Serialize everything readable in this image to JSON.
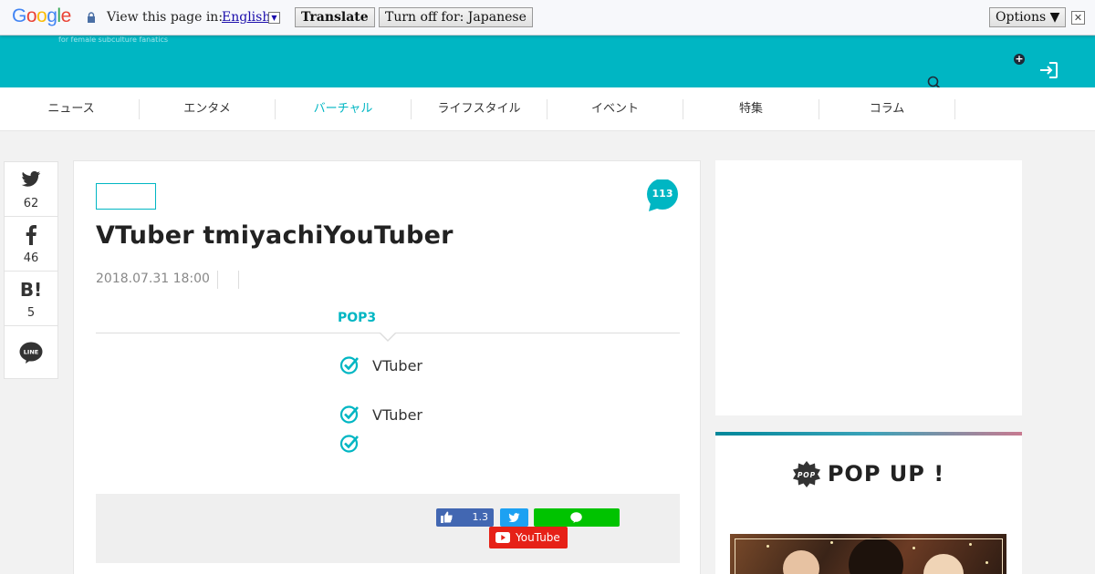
{
  "translate_bar": {
    "logo": "Google",
    "prompt": "View this page in:",
    "language": "English",
    "translate_label": "Translate",
    "turn_off_label": "Turn off for: Japanese",
    "options_label": "Options ▼",
    "close_symbol": "✕"
  },
  "header": {
    "tagline": "for female subculture fanatics",
    "colors": {
      "brand": "#00b6c3"
    }
  },
  "nav": {
    "items": [
      {
        "label": "ニュース"
      },
      {
        "label": "エンタメ"
      },
      {
        "label": "バーチャル"
      },
      {
        "label": "ライフスタイル"
      },
      {
        "label": "イベント"
      },
      {
        "label": "特集"
      },
      {
        "label": "コラム"
      }
    ],
    "active_index": 2
  },
  "share": {
    "twitter_count": "62",
    "facebook_count": "46",
    "hatena_label": "B!",
    "hatena_count": "5",
    "line_label": "LINE"
  },
  "article": {
    "comment_count": "113",
    "title": "VTuber tmiyachiYouTuber",
    "date": "2018.07.31 18:00",
    "pop_label": "POP3",
    "points": [
      "VTuber",
      "VTuber",
      ""
    ],
    "social": {
      "like_count": "1.3",
      "youtube_label": "YouTube"
    }
  },
  "sidebar": {
    "popup_title": "POP UP !",
    "popup_badge": "POP"
  }
}
